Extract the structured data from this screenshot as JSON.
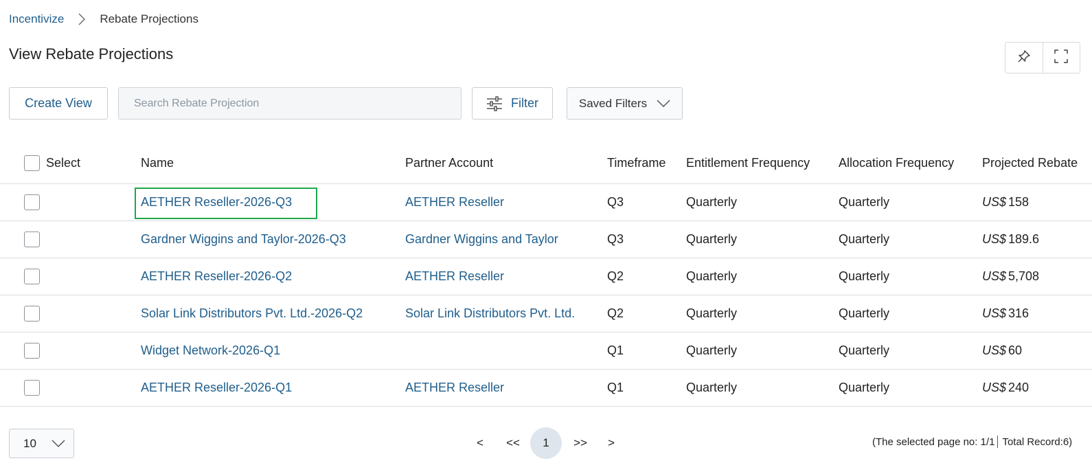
{
  "breadcrumb": {
    "root": "Incentivize",
    "current": "Rebate Projections"
  },
  "page": {
    "title": "View Rebate Projections"
  },
  "toolbar": {
    "create_label": "Create View",
    "search_placeholder": "Search Rebate Projection",
    "search_value": "",
    "filter_label": "Filter",
    "saved_filters_label": "Saved Filters"
  },
  "table": {
    "columns": {
      "select": "Select",
      "name": "Name",
      "partner": "Partner Account",
      "timeframe": "Timeframe",
      "entitlement": "Entitlement Frequency",
      "allocation": "Allocation Frequency",
      "projected": "Projected Rebate"
    },
    "currency_prefix": "US$",
    "rows": [
      {
        "name": "AETHER Reseller-2026-Q3",
        "partner": "AETHER Reseller",
        "timeframe": "Q3",
        "entitlement": "Quarterly",
        "allocation": "Quarterly",
        "amount": "158",
        "checked": false,
        "highlighted": true
      },
      {
        "name": "Gardner Wiggins and Taylor-2026-Q3",
        "partner": "Gardner Wiggins and Taylor",
        "timeframe": "Q3",
        "entitlement": "Quarterly",
        "allocation": "Quarterly",
        "amount": "189.6",
        "checked": false,
        "highlighted": false
      },
      {
        "name": "AETHER Reseller-2026-Q2",
        "partner": "AETHER Reseller",
        "timeframe": "Q2",
        "entitlement": "Quarterly",
        "allocation": "Quarterly",
        "amount": "5,708",
        "checked": false,
        "highlighted": false
      },
      {
        "name": "Solar Link Distributors Pvt. Ltd.-2026-Q2",
        "partner": "Solar Link Distributors Pvt. Ltd.",
        "timeframe": "Q2",
        "entitlement": "Quarterly",
        "allocation": "Quarterly",
        "amount": "316",
        "checked": false,
        "highlighted": false
      },
      {
        "name": "Widget Network-2026-Q1",
        "partner": "",
        "timeframe": "Q1",
        "entitlement": "Quarterly",
        "allocation": "Quarterly",
        "amount": "60",
        "checked": false,
        "highlighted": false
      },
      {
        "name": "AETHER Reseller-2026-Q1",
        "partner": "AETHER Reseller",
        "timeframe": "Q1",
        "entitlement": "Quarterly",
        "allocation": "Quarterly",
        "amount": "240",
        "checked": false,
        "highlighted": false
      }
    ]
  },
  "pagination": {
    "page_size": "10",
    "prev": "<",
    "first": "<<",
    "current": "1",
    "last": ">>",
    "next": ">",
    "selected_page_text": "(The selected page no: 1/1",
    "total_text": "Total Record:6)"
  },
  "colors": {
    "link": "#1f5e8c",
    "highlight": "#1ea84a",
    "current_page_bg": "#dfe5ec"
  },
  "icons": {
    "breadcrumb_separator": "chevron-right-icon",
    "pin": "pin-icon",
    "fullscreen": "fullscreen-icon",
    "filter": "sliders-icon",
    "dropdown": "chevron-down-icon"
  }
}
